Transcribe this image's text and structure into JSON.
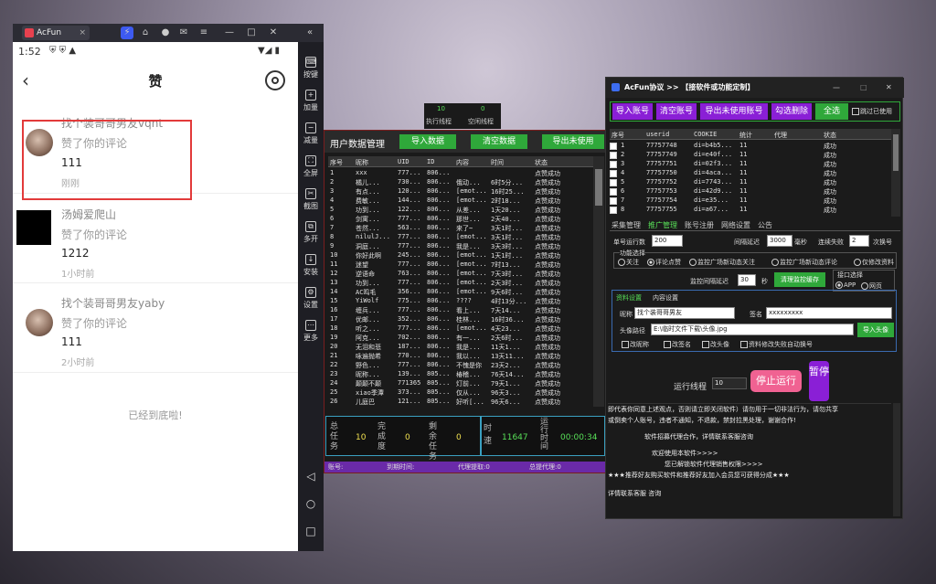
{
  "emulator": {
    "tab_title": "AcFun",
    "tab_close": "×",
    "controls": [
      "—",
      "□",
      "✕",
      "«"
    ],
    "side_buttons": [
      "按键",
      "加量",
      "减量",
      "全屏",
      "截图",
      "多开",
      "安装",
      "设置",
      "更多"
    ]
  },
  "phone": {
    "status_time": "1:52",
    "title": "赞",
    "notifications": [
      {
        "nickname": "找个装哥哥男友vqnt",
        "action": "赞了你的评论",
        "comment": "111",
        "time": "刚刚"
      },
      {
        "nickname": "汤姆爱爬山",
        "action": "赞了你的评论",
        "comment": "1212",
        "time": "1小时前"
      },
      {
        "nickname": "找个装哥哥男友yaby",
        "action": "赞了你的评论",
        "comment": "111",
        "time": "2小时前"
      }
    ],
    "end_text": "已经到底啦!"
  },
  "threads": {
    "running_value": "10",
    "running_label": "执行线程",
    "idle_value": "0",
    "idle_label": "空闲线程"
  },
  "tool1": {
    "title": "用户数据管理",
    "buttons": [
      "导入数据",
      "清空数据",
      "导出未使用"
    ],
    "columns": [
      "序号",
      "昵称",
      "UID",
      "ID",
      "内容",
      "时间",
      "状态"
    ],
    "rows": [
      [
        "1",
        "xxx",
        "777...",
        "806...",
        "",
        "",
        "点赞成功"
      ],
      [
        "2",
        "橘儿...",
        "730...",
        "806...",
        "俄动...",
        "6时5分...",
        "点赞成功"
      ],
      [
        "3",
        "有点...",
        "120...",
        "806...",
        "[emot...",
        "16时25...",
        "点赞成功"
      ],
      [
        "4",
        "费敏...",
        "144...",
        "806...",
        "[emot...",
        "2时18...",
        "点赞成功"
      ],
      [
        "5",
        "功到...",
        "122...",
        "806...",
        "从差...",
        "1天20...",
        "点赞成功"
      ],
      [
        "6",
        "剑寓...",
        "777...",
        "806...",
        "那世...",
        "2天40...",
        "点赞成功"
      ],
      [
        "7",
        "苍然...",
        "563...",
        "806...",
        "来了~",
        "3天1时...",
        "点赞成功"
      ],
      [
        "8",
        "nilulJ...",
        "777...",
        "806...",
        "[emot...",
        "3天1时...",
        "点赞成功"
      ],
      [
        "9",
        "洞庭...",
        "777...",
        "806...",
        "我是...",
        "3天3时...",
        "点赞成功"
      ],
      [
        "10",
        "你好此啊",
        "245...",
        "806...",
        "[emot...",
        "1天1时...",
        "点赞成功"
      ],
      [
        "11",
        "迷望",
        "777...",
        "806...",
        "[emot...",
        "7时13...",
        "点赞成功"
      ],
      [
        "12",
        "逆语命",
        "763...",
        "806...",
        "[emot...",
        "7天3时...",
        "点赞成功"
      ],
      [
        "13",
        "功到...",
        "777...",
        "806...",
        "[emot...",
        "2天3时...",
        "点赞成功"
      ],
      [
        "14",
        "AC鸣毛",
        "356...",
        "806...",
        "[emot...",
        "9天6时...",
        "点赞成功"
      ],
      [
        "15",
        "YiWolf",
        "775...",
        "806...",
        "????",
        "4时13分...",
        "点赞成功"
      ],
      [
        "16",
        "缠兵...",
        "777...",
        "806...",
        "看上...",
        "7天14...",
        "点赞成功"
      ],
      [
        "17",
        "优邮...",
        "352...",
        "806...",
        "桂林...",
        "16时36...",
        "点赞成功"
      ],
      [
        "18",
        "听之...",
        "777...",
        "806...",
        "[emot...",
        "4天23...",
        "点赞成功"
      ],
      [
        "19",
        "阿克...",
        "702...",
        "806...",
        "有一...",
        "2天6时...",
        "点赞成功"
      ],
      [
        "20",
        "无泪和悲",
        "187...",
        "806...",
        "我是...",
        "11天1...",
        "点赞成功"
      ],
      [
        "21",
        "咏遍抛希",
        "770...",
        "806...",
        "我以...",
        "13天11...",
        "点赞成功"
      ],
      [
        "22",
        "野色...",
        "777...",
        "806...",
        "不愧是你",
        "23天2...",
        "点赞成功"
      ],
      [
        "23",
        "昵称...",
        "139...",
        "805...",
        "椿稽...",
        "76天14...",
        "点赞成功"
      ],
      [
        "24",
        "颠颠不颠",
        "771365",
        "805...",
        "灯前...",
        "79天1...",
        "点赞成功"
      ],
      [
        "25",
        "xiao季潭",
        "373...",
        "805...",
        "仅从...",
        "96天3...",
        "点赞成功"
      ],
      [
        "26",
        "儿庭巴",
        "121...",
        "805...",
        "好听[...",
        "96天6...",
        "点赞成功"
      ]
    ],
    "stats": {
      "total_label": "总任务",
      "total": "10",
      "done_label": "完成度",
      "done": "0",
      "left_label": "剩余任务",
      "left": "0",
      "speed_label": "时速",
      "speed": "11647",
      "runtime_label": "运行时间",
      "runtime": "00:00:34"
    },
    "footer": {
      "account": "账号:",
      "expire": "到期时间:",
      "agent": "代理提取:0",
      "total_agent": "总提代理:0"
    }
  },
  "tool2": {
    "title": "AcFun协议 >> 【接软件或功能定制】",
    "buttons": [
      "导入账号",
      "清空账号",
      "导出未使用账号",
      "勾选删除",
      "全选"
    ],
    "skip_used": "跳过已使用",
    "columns": [
      "序号",
      "userid",
      "COOKIE",
      "统计",
      "代理",
      "状态"
    ],
    "rows": [
      [
        "1",
        "77757748",
        "di=b4b5...",
        "11",
        "",
        "成功"
      ],
      [
        "2",
        "77757749",
        "di=e40f...",
        "11",
        "",
        "成功"
      ],
      [
        "3",
        "77757751",
        "di=02f3...",
        "11",
        "",
        "成功"
      ],
      [
        "4",
        "77757750",
        "di=4aca...",
        "11",
        "",
        "成功"
      ],
      [
        "5",
        "77757752",
        "di=7743...",
        "11",
        "",
        "成功"
      ],
      [
        "6",
        "77757753",
        "di=42d9...",
        "11",
        "",
        "成功"
      ],
      [
        "7",
        "77757754",
        "di=e35...",
        "11",
        "",
        "成功"
      ],
      [
        "8",
        "77757755",
        "di=a67...",
        "11",
        "",
        "成功"
      ]
    ],
    "tabs": [
      "采集管理",
      "推广管理",
      "账号注册",
      "网络设置",
      "公告"
    ],
    "single_runs_label": "单号运行数",
    "single_runs": "200",
    "interval_label": "间隔延迟",
    "interval": "3000",
    "ms_label": "毫秒",
    "fail_label": "连续失败",
    "fail": "2",
    "switch_label": "次换号",
    "func_label": "功能选择",
    "funcs": [
      "关注",
      "评论点赞",
      "监控广场新动态关注",
      "监控广场新动态评论",
      "仅修改资料"
    ],
    "monitor_label": "监控间隔延迟",
    "monitor": "30",
    "sec_label": "秒",
    "clear_cache": "清理监控缓存",
    "api_label": "接口选择",
    "api_app": "APP",
    "api_web": "网页",
    "subtabs": [
      "资料设置",
      "内容设置"
    ],
    "nick_label": "昵称",
    "nick": "找个装哥哥男友",
    "sign_label": "签名",
    "sign": "xxxxxxxxx",
    "head_label": "头像路径",
    "head": "E:\\临时文件下载\\头像.jpg",
    "import_head": "导入头像",
    "checks": [
      "改昵称",
      "改签名",
      "改头像",
      "资料修改失败自动换号"
    ],
    "thread_label": "运行线程",
    "thread": "10",
    "stop": "停止运行",
    "pause": "暂停",
    "notice": [
      "即代表你同意上述观点，否则请立即关闭软件）请勿用于一切非法行为，请勿共享",
      "或倒卖个人账号，违者不通知，不退款，禁封拉黑处理，谢谢合作!",
      "软件招募代理合作，详情联系客服咨询",
      "欢迎使用本软件>>>>",
      "您已解锁软件代理销售权限>>>>",
      "★★★推荐好友购买软件和推荐好友加入会员您可获得分成★★★",
      "详情联系客服  咨询"
    ]
  }
}
